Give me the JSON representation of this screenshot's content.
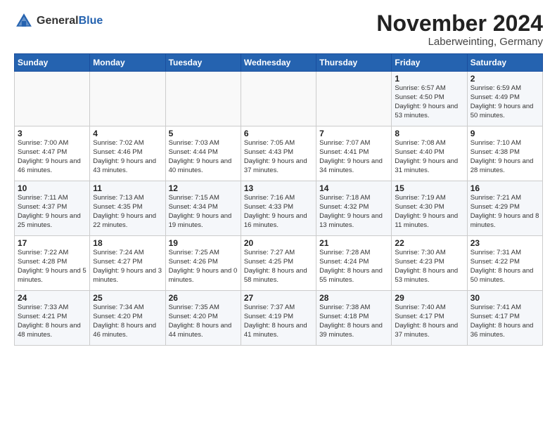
{
  "header": {
    "logo_general": "General",
    "logo_blue": "Blue",
    "month_title": "November 2024",
    "location": "Laberweinting, Germany"
  },
  "weekdays": [
    "Sunday",
    "Monday",
    "Tuesday",
    "Wednesday",
    "Thursday",
    "Friday",
    "Saturday"
  ],
  "weeks": [
    [
      {
        "day": "",
        "info": ""
      },
      {
        "day": "",
        "info": ""
      },
      {
        "day": "",
        "info": ""
      },
      {
        "day": "",
        "info": ""
      },
      {
        "day": "",
        "info": ""
      },
      {
        "day": "1",
        "info": "Sunrise: 6:57 AM\nSunset: 4:50 PM\nDaylight: 9 hours and 53 minutes."
      },
      {
        "day": "2",
        "info": "Sunrise: 6:59 AM\nSunset: 4:49 PM\nDaylight: 9 hours and 50 minutes."
      }
    ],
    [
      {
        "day": "3",
        "info": "Sunrise: 7:00 AM\nSunset: 4:47 PM\nDaylight: 9 hours and 46 minutes."
      },
      {
        "day": "4",
        "info": "Sunrise: 7:02 AM\nSunset: 4:46 PM\nDaylight: 9 hours and 43 minutes."
      },
      {
        "day": "5",
        "info": "Sunrise: 7:03 AM\nSunset: 4:44 PM\nDaylight: 9 hours and 40 minutes."
      },
      {
        "day": "6",
        "info": "Sunrise: 7:05 AM\nSunset: 4:43 PM\nDaylight: 9 hours and 37 minutes."
      },
      {
        "day": "7",
        "info": "Sunrise: 7:07 AM\nSunset: 4:41 PM\nDaylight: 9 hours and 34 minutes."
      },
      {
        "day": "8",
        "info": "Sunrise: 7:08 AM\nSunset: 4:40 PM\nDaylight: 9 hours and 31 minutes."
      },
      {
        "day": "9",
        "info": "Sunrise: 7:10 AM\nSunset: 4:38 PM\nDaylight: 9 hours and 28 minutes."
      }
    ],
    [
      {
        "day": "10",
        "info": "Sunrise: 7:11 AM\nSunset: 4:37 PM\nDaylight: 9 hours and 25 minutes."
      },
      {
        "day": "11",
        "info": "Sunrise: 7:13 AM\nSunset: 4:35 PM\nDaylight: 9 hours and 22 minutes."
      },
      {
        "day": "12",
        "info": "Sunrise: 7:15 AM\nSunset: 4:34 PM\nDaylight: 9 hours and 19 minutes."
      },
      {
        "day": "13",
        "info": "Sunrise: 7:16 AM\nSunset: 4:33 PM\nDaylight: 9 hours and 16 minutes."
      },
      {
        "day": "14",
        "info": "Sunrise: 7:18 AM\nSunset: 4:32 PM\nDaylight: 9 hours and 13 minutes."
      },
      {
        "day": "15",
        "info": "Sunrise: 7:19 AM\nSunset: 4:30 PM\nDaylight: 9 hours and 11 minutes."
      },
      {
        "day": "16",
        "info": "Sunrise: 7:21 AM\nSunset: 4:29 PM\nDaylight: 9 hours and 8 minutes."
      }
    ],
    [
      {
        "day": "17",
        "info": "Sunrise: 7:22 AM\nSunset: 4:28 PM\nDaylight: 9 hours and 5 minutes."
      },
      {
        "day": "18",
        "info": "Sunrise: 7:24 AM\nSunset: 4:27 PM\nDaylight: 9 hours and 3 minutes."
      },
      {
        "day": "19",
        "info": "Sunrise: 7:25 AM\nSunset: 4:26 PM\nDaylight: 9 hours and 0 minutes."
      },
      {
        "day": "20",
        "info": "Sunrise: 7:27 AM\nSunset: 4:25 PM\nDaylight: 8 hours and 58 minutes."
      },
      {
        "day": "21",
        "info": "Sunrise: 7:28 AM\nSunset: 4:24 PM\nDaylight: 8 hours and 55 minutes."
      },
      {
        "day": "22",
        "info": "Sunrise: 7:30 AM\nSunset: 4:23 PM\nDaylight: 8 hours and 53 minutes."
      },
      {
        "day": "23",
        "info": "Sunrise: 7:31 AM\nSunset: 4:22 PM\nDaylight: 8 hours and 50 minutes."
      }
    ],
    [
      {
        "day": "24",
        "info": "Sunrise: 7:33 AM\nSunset: 4:21 PM\nDaylight: 8 hours and 48 minutes."
      },
      {
        "day": "25",
        "info": "Sunrise: 7:34 AM\nSunset: 4:20 PM\nDaylight: 8 hours and 46 minutes."
      },
      {
        "day": "26",
        "info": "Sunrise: 7:35 AM\nSunset: 4:20 PM\nDaylight: 8 hours and 44 minutes."
      },
      {
        "day": "27",
        "info": "Sunrise: 7:37 AM\nSunset: 4:19 PM\nDaylight: 8 hours and 41 minutes."
      },
      {
        "day": "28",
        "info": "Sunrise: 7:38 AM\nSunset: 4:18 PM\nDaylight: 8 hours and 39 minutes."
      },
      {
        "day": "29",
        "info": "Sunrise: 7:40 AM\nSunset: 4:17 PM\nDaylight: 8 hours and 37 minutes."
      },
      {
        "day": "30",
        "info": "Sunrise: 7:41 AM\nSunset: 4:17 PM\nDaylight: 8 hours and 36 minutes."
      }
    ]
  ]
}
